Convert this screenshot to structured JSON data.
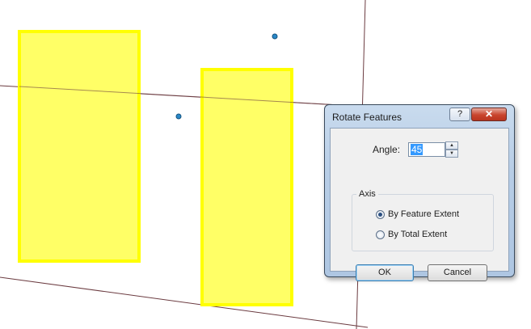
{
  "dialog": {
    "title": "Rotate Features",
    "help_glyph": "?",
    "close_glyph": "✕",
    "angle_label": "Angle:",
    "angle_value": "45",
    "axis_group_label": "Axis",
    "radio_options": [
      {
        "label": "By Feature Extent",
        "checked": true
      },
      {
        "label": "By Total Extent",
        "checked": false
      }
    ],
    "ok_label": "OK",
    "cancel_label": "Cancel"
  },
  "map": {
    "feature_fill": "#ffff66",
    "feature_stroke": "#ffff00",
    "line_color": "#6b3b40",
    "point_color": "#2a88c8"
  },
  "icons": {
    "help": "help-icon",
    "close": "close-icon",
    "spin_up": "chevron-up-icon",
    "spin_down": "chevron-down-icon"
  }
}
